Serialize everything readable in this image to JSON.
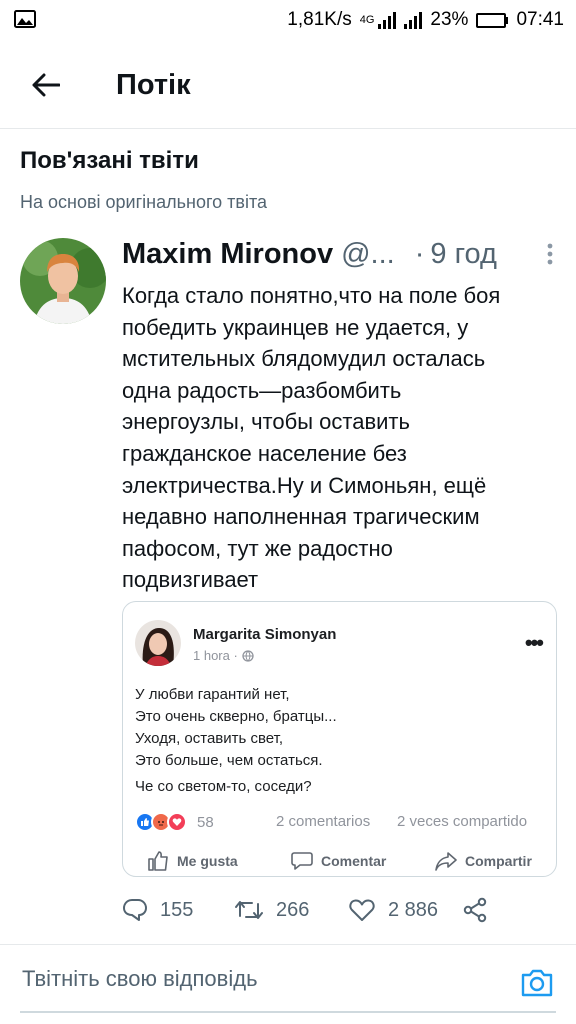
{
  "status_bar": {
    "speed": "1,81K/s",
    "network": "4G",
    "battery": "23%",
    "battery_level": 0.23,
    "time": "07:41",
    "icons": [
      "image-notification-icon",
      "signal-icon",
      "signal-icon",
      "battery-icon"
    ]
  },
  "header": {
    "title": "Потік",
    "back_icon": "arrow-left-icon"
  },
  "section": {
    "title": "Пов'язані твіти",
    "subtitle": "На основі оригінального твіта"
  },
  "tweet": {
    "author": "Maxim Mironov",
    "handle": "@...",
    "separator": "·",
    "time": "9 год",
    "text": "Когда стало понятно,что на поле боя\nпобедить украинцев не удается, у\nмстительных блядомудил осталась\nодна радость—разбомбить\nэнергоузлы, чтобы оставить\nгражданское население без\nэлектричества.Ну и Симоньян, ещё\nнедавно наполненная трагическим\nпафосом, тут же радостно\nподвизгивает",
    "media": {
      "name": "Margarita Simonyan",
      "meta": "1 hora ·",
      "poem": "У любви гарантий нет,\nЭто очень скверно, братцы...\nУходя, оставить свет,\nЭто больше, чем остаться.",
      "question": "Че со светом-то, соседи?",
      "reactions_count": "58",
      "comments": "2 comentarios",
      "shares": "2 veces compartido",
      "like": "Me gusta",
      "comment": "Comentar",
      "share": "Compartir",
      "colors": {
        "like": "#1877f2",
        "angry": "#f0684a",
        "love": "#f33e58"
      }
    },
    "stats": {
      "replies": "155",
      "retweets": "266",
      "likes": "2 886"
    }
  },
  "reply": {
    "placeholder": "Твітніть свою відповідь"
  },
  "colors": {
    "accent": "#1d9bf0",
    "secondary_text": "#536471",
    "divider": "#e6e9eb"
  }
}
